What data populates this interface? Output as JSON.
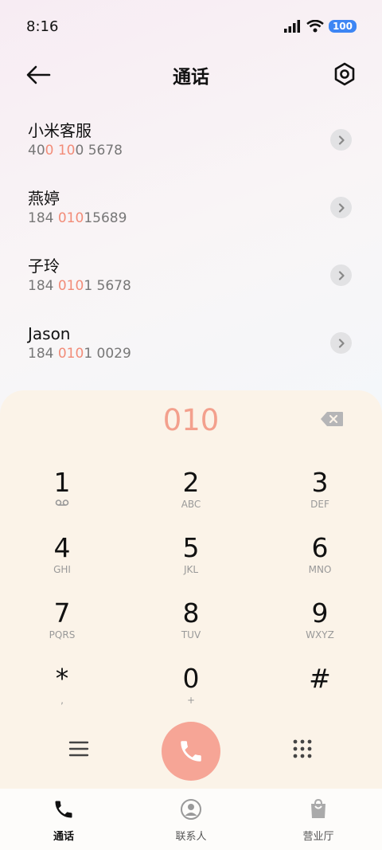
{
  "status_bar": {
    "time": "8:16",
    "battery": "100"
  },
  "header": {
    "title": "通话"
  },
  "results": [
    {
      "name": "小米客服",
      "number_parts": [
        "40",
        "0 10",
        "0 5678"
      ]
    },
    {
      "name": "燕婷",
      "number_parts": [
        "184 ",
        "010",
        "15689"
      ]
    },
    {
      "name": "子玲",
      "number_parts": [
        "184 ",
        "010",
        "1 5678"
      ]
    },
    {
      "name": "Jason",
      "number_parts": [
        "184 ",
        "010",
        "1 0029"
      ]
    }
  ],
  "dialer": {
    "input": "010",
    "keys": [
      {
        "digit": "1",
        "sub": "voicemail"
      },
      {
        "digit": "2",
        "sub": "ABC"
      },
      {
        "digit": "3",
        "sub": "DEF"
      },
      {
        "digit": "4",
        "sub": "GHI"
      },
      {
        "digit": "5",
        "sub": "JKL"
      },
      {
        "digit": "6",
        "sub": "MNO"
      },
      {
        "digit": "7",
        "sub": "PQRS"
      },
      {
        "digit": "8",
        "sub": "TUV"
      },
      {
        "digit": "9",
        "sub": "WXYZ"
      },
      {
        "digit": "*",
        "sub": ","
      },
      {
        "digit": "0",
        "sub": "+"
      },
      {
        "digit": "#",
        "sub": ""
      }
    ]
  },
  "bottom_nav": {
    "calls": "通话",
    "contacts": "联系人",
    "store": "营业厅"
  },
  "colors": {
    "accent": "#f3a08d",
    "call_button": "#f6a596",
    "battery": "#3d86f4"
  }
}
